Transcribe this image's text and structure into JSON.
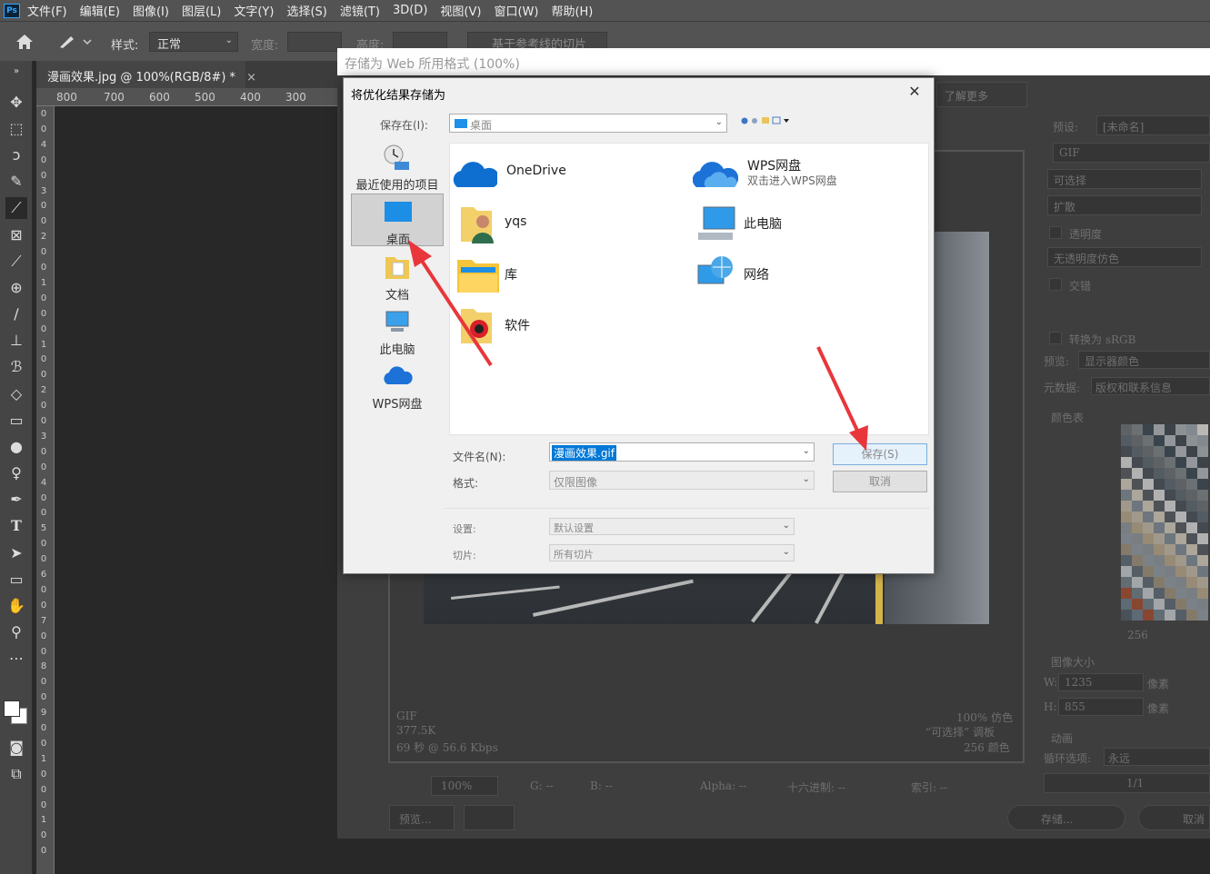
{
  "menubar": {
    "logo": "Ps",
    "items": [
      "文件(F)",
      "编辑(E)",
      "图像(I)",
      "图层(L)",
      "文字(Y)",
      "选择(S)",
      "滤镜(T)",
      "3D(D)",
      "视图(V)",
      "窗口(W)",
      "帮助(H)"
    ]
  },
  "options": {
    "style_label": "样式:",
    "style_value": "正常",
    "width_label": "宽度:",
    "height_label": "高度:",
    "slices_button": "基于参考线的切片"
  },
  "document": {
    "tab_title": "漫画效果.jpg @ 100%(RGB/8#) *",
    "close": "×",
    "ruler_h": [
      "800",
      "700",
      "600",
      "500",
      "400",
      "300"
    ],
    "ruler_v": [
      "0",
      "0",
      "4",
      "0",
      "0",
      "3",
      "0",
      "0",
      "2",
      "0",
      "0",
      "1",
      "0",
      "0",
      "0",
      "1",
      "0",
      "0",
      "2",
      "0",
      "0",
      "3",
      "0",
      "0",
      "4",
      "0",
      "0",
      "5",
      "0",
      "0",
      "6",
      "0",
      "0",
      "7",
      "0",
      "0",
      "8",
      "0",
      "0",
      "9",
      "0",
      "0",
      "1",
      "0",
      "0",
      "0",
      "1",
      "0",
      "0"
    ]
  },
  "sfw": {
    "title": "存储为 Web 所用格式 (100%)",
    "learn_more": "了解更多",
    "preset_label": "预设:",
    "preset_value": "[未命名]",
    "format_value": "GIF",
    "reduction_value": "可选择",
    "dither_value": "扩散",
    "transparency_label": "透明度",
    "matte_value": "无透明度仿色",
    "interlaced_label": "交错",
    "srgb_label": "转换为 sRGB",
    "preview_label": "预览:",
    "preview_value": "显示器颜色",
    "metadata_label": "元数据:",
    "metadata_value": "版权和联系信息",
    "color_table_label": "颜色表",
    "color_count": "256",
    "image_size_label": "图像大小",
    "w_label": "W:",
    "w_value": "1235",
    "h_label": "H:",
    "h_value": "855",
    "px_unit": "像素",
    "animation_label": "动画",
    "loop_label": "循环选项:",
    "loop_value": "永远",
    "frame_value": "1/1",
    "info_left": [
      "GIF",
      "377.5K",
      "69 秒 @ 56.6 Kbps"
    ],
    "info_right": [
      "100% 仿色",
      "“可选择” 调板",
      "256 颜色"
    ],
    "zoom_value": "100%",
    "g_label": "G: --",
    "b_label": "B: --",
    "alpha_label": "Alpha: --",
    "hex_label": "十六进制: --",
    "index_label": "索引: --",
    "preview_button": "预览...",
    "save_button": "存储...",
    "cancel_button": "取消"
  },
  "dialog": {
    "title": "将优化结果存储为",
    "close": "✕",
    "save_in_label": "保存在(I):",
    "save_in_value": "桌面",
    "places": [
      {
        "label": "最近使用的项目"
      },
      {
        "label": "桌面"
      },
      {
        "label": "文档"
      },
      {
        "label": "此电脑"
      },
      {
        "label": "WPS网盘"
      }
    ],
    "files": [
      {
        "name": "OneDrive"
      },
      {
        "name": "WPS网盘",
        "sub": "双击进入WPS网盘"
      },
      {
        "name": "yqs"
      },
      {
        "name": "此电脑"
      },
      {
        "name": "库"
      },
      {
        "name": "网络"
      },
      {
        "name": "软件"
      }
    ],
    "filename_label": "文件名(N):",
    "filename_value": "漫画效果.gif",
    "format_label": "格式:",
    "format_value": "仅限图像",
    "settings_label": "设置:",
    "settings_value": "默认设置",
    "slices_label": "切片:",
    "slices_value": "所有切片",
    "save_button": "保存(S)",
    "cancel_button": "取消"
  },
  "colors": {
    "ps_panel": "#535353",
    "annotation_arrow": "#e8363b",
    "selection": "#0078d7"
  }
}
